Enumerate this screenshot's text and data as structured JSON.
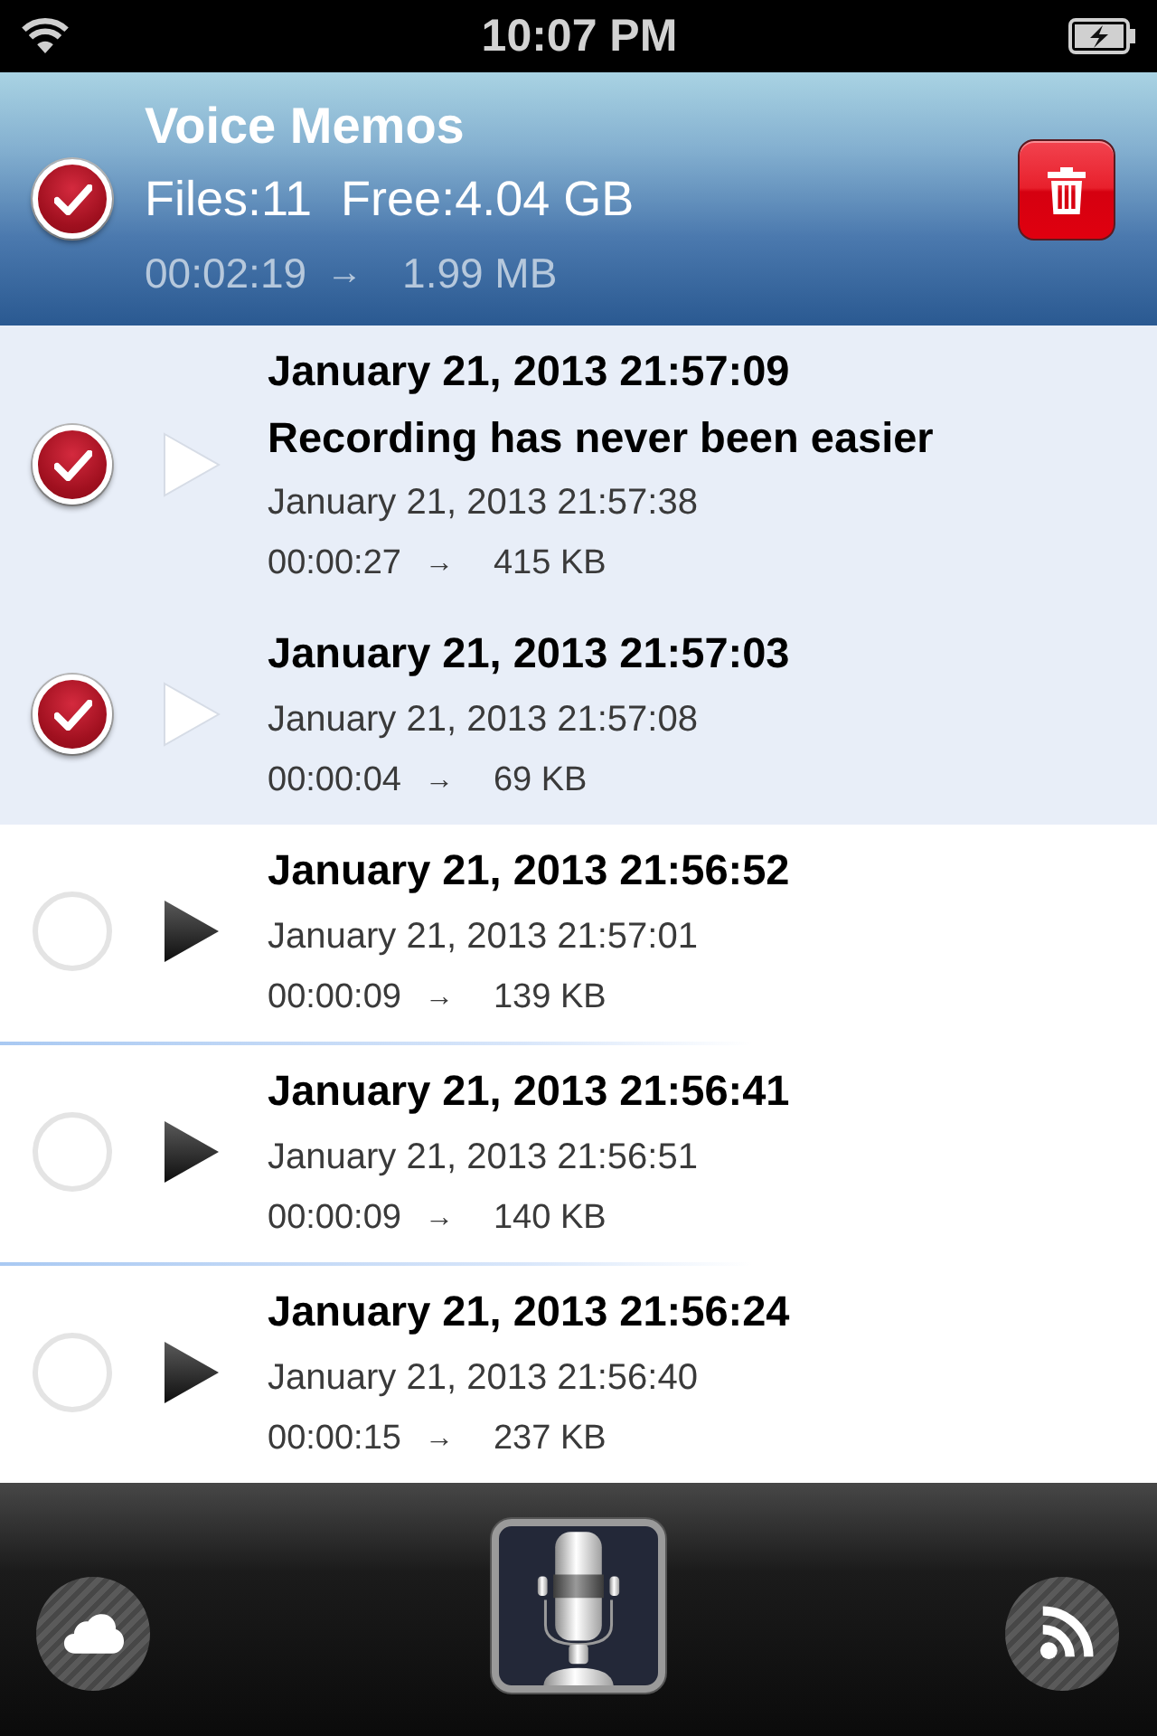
{
  "status_bar": {
    "time": "10:07 PM"
  },
  "header": {
    "title": "Voice Memos",
    "checked": true,
    "files": "Files:11",
    "free": "Free:4.04 GB",
    "duration": "00:02:19",
    "arrow": "→",
    "size": "1.99 MB"
  },
  "rows": [
    {
      "title": "January 21, 2013 21:57:09",
      "note": "Recording has never been easier",
      "recorded": "January 21, 2013 21:57:38",
      "duration": "00:00:27",
      "arrow": "→",
      "size": "415 KB",
      "checked": true
    },
    {
      "title": "January 21, 2013 21:57:03",
      "recorded": "January 21, 2013 21:57:08",
      "duration": "00:00:04",
      "arrow": "→",
      "size": "69 KB",
      "checked": true
    },
    {
      "title": "January 21, 2013 21:56:52",
      "recorded": "January 21, 2013 21:57:01",
      "duration": "00:00:09",
      "arrow": "→",
      "size": "139 KB",
      "checked": false
    },
    {
      "title": "January 21, 2013 21:56:41",
      "recorded": "January 21, 2013 21:56:51",
      "duration": "00:00:09",
      "arrow": "→",
      "size": "140 KB",
      "checked": false
    },
    {
      "title": "January 21, 2013 21:56:24",
      "recorded": "January 21, 2013 21:56:40",
      "duration": "00:00:15",
      "arrow": "→",
      "size": "237 KB",
      "checked": false
    }
  ]
}
